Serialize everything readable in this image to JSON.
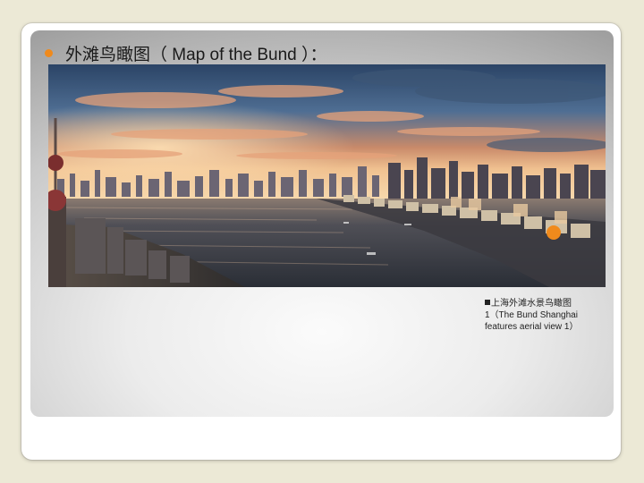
{
  "slide": {
    "bullet_color": "#f08a1c",
    "title_cn": "外滩鸟瞰图",
    "title_en": "（ Map of the Bund ）：",
    "caption": {
      "marker_icon": "square-bullet-icon",
      "line1": "上海外滩水景鸟瞰图",
      "line2": "1（The Bund Shanghai",
      "line3": "features aerial view 1）"
    }
  },
  "colors": {
    "background": "#ece9d6",
    "accent_orange": "#f08a1c",
    "sky_top": "#2c4a6e",
    "sunset": "#f2b27a",
    "water": "#3a3f48"
  }
}
